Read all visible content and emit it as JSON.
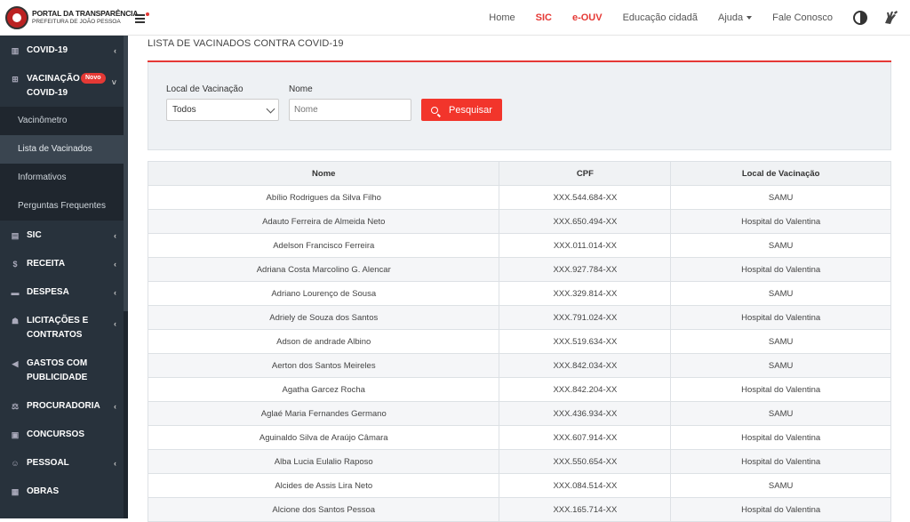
{
  "header": {
    "logo_line1": "PORTAL DA TRANSPARÊNCIA",
    "logo_line2": "PREFEITURA DE JOÃO PESSOA",
    "nav": [
      {
        "label": "Home",
        "style": "normal"
      },
      {
        "label": "SIC",
        "style": "red"
      },
      {
        "label": "e-OUV",
        "style": "red"
      },
      {
        "label": "Educação cidadã",
        "style": "normal"
      },
      {
        "label": "Ajuda",
        "style": "dropdown"
      },
      {
        "label": "Fale Conosco",
        "style": "normal"
      }
    ]
  },
  "sidebar": {
    "items": [
      {
        "label": "COVID-19",
        "icon": "building-icon",
        "has_chevron": true
      },
      {
        "label": "VACINAÇÃO COVID-19",
        "badge": "Novo",
        "icon": "plus-square-icon",
        "has_chevron": true,
        "expanded": true
      },
      {
        "label": "SIC",
        "icon": "document-icon",
        "has_chevron": true
      },
      {
        "label": "RECEITA",
        "icon": "dollar-icon",
        "has_chevron": true
      },
      {
        "label": "DESPESA",
        "icon": "cart-icon",
        "has_chevron": true
      },
      {
        "label": "LICITAÇÕES E CONTRATOS",
        "icon": "users-icon",
        "has_chevron": true
      },
      {
        "label": "GASTOS COM PUBLICIDADE",
        "icon": "megaphone-icon",
        "has_chevron": false
      },
      {
        "label": "PROCURADORIA",
        "icon": "scale-icon",
        "has_chevron": true
      },
      {
        "label": "CONCURSOS",
        "icon": "book-icon",
        "has_chevron": false
      },
      {
        "label": "PESSOAL",
        "icon": "person-icon",
        "has_chevron": true
      },
      {
        "label": "OBRAS",
        "icon": "clipboard-icon",
        "has_chevron": false
      }
    ],
    "submenu": [
      {
        "label": "Vacinômetro",
        "active": false
      },
      {
        "label": "Lista de Vacinados",
        "active": true
      },
      {
        "label": "Informativos",
        "active": false
      },
      {
        "label": "Perguntas Frequentes",
        "active": false
      }
    ]
  },
  "main": {
    "title": "LISTA DE VACINADOS CONTRA COVID-19",
    "filters": {
      "local_label": "Local de Vacinação",
      "local_value": "Todos",
      "nome_label": "Nome",
      "nome_placeholder": "Nome",
      "search_button": "Pesquisar"
    },
    "table": {
      "headers": [
        "Nome",
        "CPF",
        "Local de Vacinação"
      ],
      "rows": [
        [
          "Abílio Rodrigues da Silva Filho",
          "XXX.544.684-XX",
          "SAMU"
        ],
        [
          "Adauto Ferreira de Almeida Neto",
          "XXX.650.494-XX",
          "Hospital do Valentina"
        ],
        [
          "Adelson Francisco Ferreira",
          "XXX.011.014-XX",
          "SAMU"
        ],
        [
          "Adriana Costa Marcolino G. Alencar",
          "XXX.927.784-XX",
          "Hospital do Valentina"
        ],
        [
          "Adriano Lourenço de Sousa",
          "XXX.329.814-XX",
          "SAMU"
        ],
        [
          "Adriely de Souza dos Santos",
          "XXX.791.024-XX",
          "Hospital do Valentina"
        ],
        [
          "Adson de andrade Albino",
          "XXX.519.634-XX",
          "SAMU"
        ],
        [
          "Aerton dos Santos Meireles",
          "XXX.842.034-XX",
          "SAMU"
        ],
        [
          "Agatha Garcez Rocha",
          "XXX.842.204-XX",
          "Hospital do Valentina"
        ],
        [
          "Aglaé Maria Fernandes Germano",
          "XXX.436.934-XX",
          "SAMU"
        ],
        [
          "Aguinaldo Silva de Araújo Câmara",
          "XXX.607.914-XX",
          "Hospital do Valentina"
        ],
        [
          "Alba Lucia Eulalio Raposo",
          "XXX.550.654-XX",
          "Hospital do Valentina"
        ],
        [
          "Alcides de Assis Lira Neto",
          "XXX.084.514-XX",
          "SAMU"
        ],
        [
          "Alcione dos Santos Pessoa",
          "XXX.165.714-XX",
          "Hospital do Valentina"
        ]
      ]
    }
  },
  "colors": {
    "accent": "#e53935",
    "sidebar_bg": "#28323c",
    "button": "#f2352b"
  }
}
